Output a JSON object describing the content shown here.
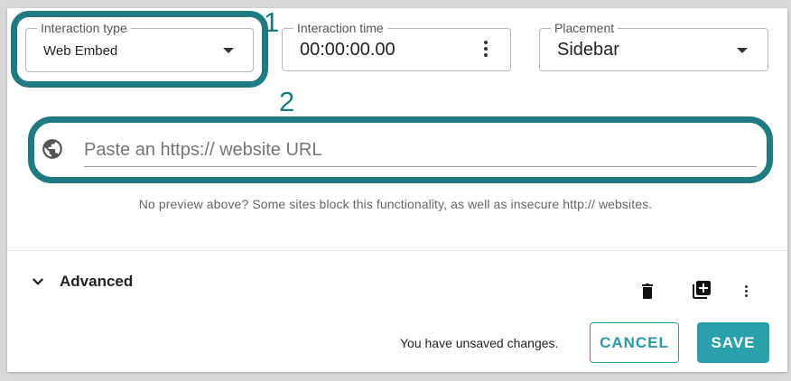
{
  "annotations": {
    "marker_1": "1",
    "marker_2": "2",
    "highlight_color": "#1f7a82"
  },
  "fields": {
    "interaction_type": {
      "label": "Interaction type",
      "value": "Web Embed"
    },
    "interaction_time": {
      "label": "Interaction time",
      "value": "00:00:00.00"
    },
    "placement": {
      "label": "Placement",
      "value": "Sidebar"
    }
  },
  "url_input": {
    "placeholder": "Paste an https:// website URL",
    "icon": "globe-icon"
  },
  "hint_text": "No preview above? Some sites block this functionality, as well as insecure http:// websites.",
  "advanced": {
    "label": "Advanced"
  },
  "toolbar_icons": [
    "delete-icon",
    "duplicate-icon",
    "more-vert-icon"
  ],
  "footer": {
    "unsaved_text": "You have unsaved changes.",
    "cancel_label": "CANCEL",
    "save_label": "SAVE"
  },
  "colors": {
    "accent": "#2aa0aa",
    "cancel_text": "#2a9aa3",
    "background": "#d9d9d9"
  }
}
